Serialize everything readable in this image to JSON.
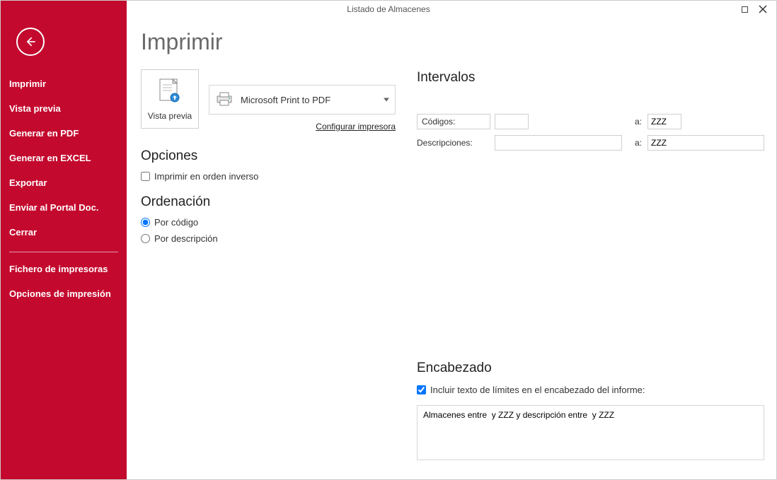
{
  "window": {
    "title": "Listado de Almacenes"
  },
  "sidebar": {
    "items": [
      "Imprimir",
      "Vista previa",
      "Generar en PDF",
      "Generar en EXCEL",
      "Exportar",
      "Enviar al Portal Doc.",
      "Cerrar"
    ],
    "items2": [
      "Fichero de impresoras",
      "Opciones de impresión"
    ]
  },
  "main": {
    "heading": "Imprimir",
    "previewLabel": "Vista previa",
    "printerName": "Microsoft Print to PDF",
    "configLink": "Configurar impresora"
  },
  "opciones": {
    "heading": "Opciones",
    "reverseLabel": "Imprimir en orden inverso",
    "reverseChecked": false
  },
  "ordenacion": {
    "heading": "Ordenación",
    "byCodeLabel": "Por código",
    "byDescLabel": "Por descripción",
    "selected": "code"
  },
  "intervalos": {
    "heading": "Intervalos",
    "codigosLabel": "Códigos:",
    "descLabel": "Descripciones:",
    "aLabel": "a:",
    "codigosFrom": "",
    "codigosTo": "ZZZ",
    "descFrom": "",
    "descTo": "ZZZ"
  },
  "encabezado": {
    "heading": "Encabezado",
    "includeLabel": "Incluir texto de límites en el encabezado del informe:",
    "includeChecked": true,
    "text": "Almacenes entre  y ZZZ y descripción entre  y ZZZ"
  }
}
